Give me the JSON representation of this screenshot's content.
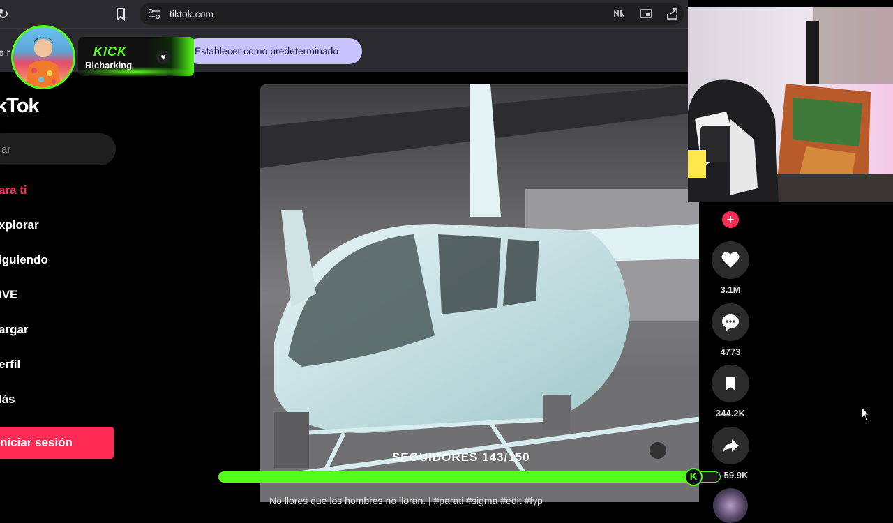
{
  "browser": {
    "url": "tiktok.com",
    "reload_icon": "reload-icon",
    "bookmark_icon": "bookmark-icon",
    "site_settings_icon": "site-settings-icon"
  },
  "infobar": {
    "fragment": "e r",
    "default_button": "Establecer como predeterminado"
  },
  "kick_overlay": {
    "brand": "KICK",
    "username": "Richarking"
  },
  "sidebar": {
    "logo": "kTok",
    "search_placeholder": "ar",
    "items": [
      {
        "label": "ara ti",
        "active": true
      },
      {
        "label": "xplorar"
      },
      {
        "label": "iguiendo"
      },
      {
        "label": "IVE"
      },
      {
        "label": "argar"
      },
      {
        "label": "erfil"
      },
      {
        "label": "lás"
      }
    ],
    "login_button": "niciar sesión"
  },
  "actions": {
    "likes": "3.1M",
    "comments": "4773",
    "saves": "344.2K",
    "shares": "59.9K"
  },
  "video": {
    "caption": "No llores que los hombres no lloran. | #parati #sigma #edit #fyp"
  },
  "followers_goal": {
    "label": "SEGUIDORES 143/150",
    "current": 143,
    "goal": 150,
    "badge": "K"
  },
  "colors": {
    "tiktok_red": "#fe2c55",
    "kick_green": "#53fc18",
    "infobar_button": "#c6c3ff"
  }
}
